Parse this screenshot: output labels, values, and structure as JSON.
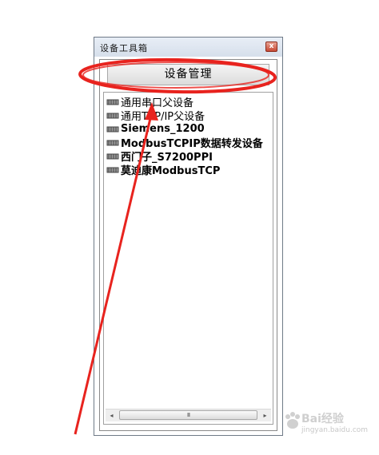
{
  "window": {
    "title": "设备工具箱",
    "close_label": "x"
  },
  "toolbar": {
    "manage_label": "设备管理"
  },
  "device_tree": {
    "items": [
      {
        "label": "通用串口父设备",
        "icon": "device-icon"
      },
      {
        "label": "通用TCP/IP父设备",
        "icon": "device-icon"
      },
      {
        "label": "Siemens_1200",
        "icon": "device-icon"
      },
      {
        "label": "ModbusTCPIP数据转发设备",
        "icon": "device-icon"
      },
      {
        "label": "西门子_S7200PPI",
        "icon": "device-icon"
      },
      {
        "label": "莫迪康ModbusTCP",
        "icon": "device-icon"
      }
    ]
  },
  "scrollbar": {
    "left_arrow": "◂",
    "right_arrow": "▸",
    "grip": "III"
  },
  "annotation": {
    "color": "#e8231e"
  },
  "watermark": {
    "brand": "Bai经验",
    "url": "jingyan.baidu.com"
  }
}
